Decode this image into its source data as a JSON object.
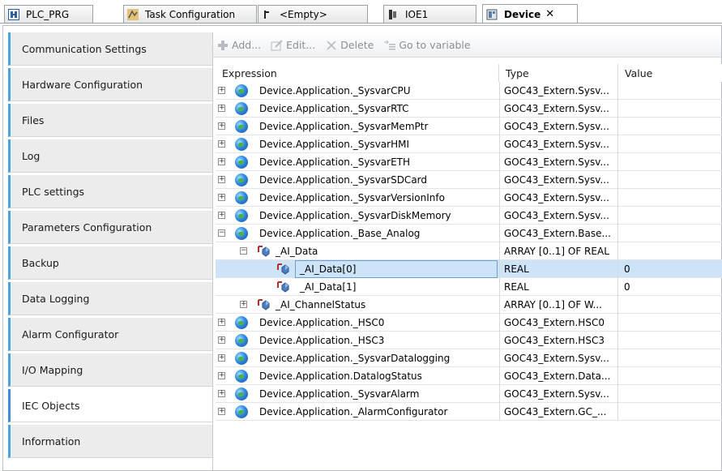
{
  "tabs": [
    {
      "label": "PLC_PRG",
      "icon": "program-icon"
    },
    {
      "label": "Task Configuration",
      "icon": "task-config-icon"
    },
    {
      "label": "<Empty>",
      "icon": "empty-icon"
    },
    {
      "label": "IOE1",
      "icon": "io-module-icon"
    },
    {
      "label": "Device",
      "icon": "device-icon",
      "close": "✕"
    }
  ],
  "sidebar": {
    "items": [
      {
        "label": "Communication Settings"
      },
      {
        "label": "Hardware Configuration"
      },
      {
        "label": "Files"
      },
      {
        "label": "Log"
      },
      {
        "label": "PLC settings"
      },
      {
        "label": "Parameters Configuration"
      },
      {
        "label": "Backup"
      },
      {
        "label": "Data Logging"
      },
      {
        "label": "Alarm Configurator"
      },
      {
        "label": "I/O Mapping"
      },
      {
        "label": "IEC Objects"
      },
      {
        "label": "Information"
      }
    ],
    "active": "IEC Objects"
  },
  "toolbar": {
    "add_label": "Add...",
    "edit_label": "Edit...",
    "delete_label": "Delete",
    "goto_label": "Go to variable"
  },
  "table": {
    "headers": {
      "expression": "Expression",
      "type": "Type",
      "value": "Value"
    },
    "rows": [
      {
        "expression": "Device.Application._SysvarCPU",
        "type": "GOC43_Extern.Sysv...",
        "value": "",
        "level": 0,
        "toggle": "+",
        "icon": "globe"
      },
      {
        "expression": "Device.Application._SysvarRTC",
        "type": "GOC43_Extern.Sysv...",
        "value": "",
        "level": 0,
        "toggle": "+",
        "icon": "globe"
      },
      {
        "expression": "Device.Application._SysvarMemPtr",
        "type": "GOC43_Extern.Sysv...",
        "value": "",
        "level": 0,
        "toggle": "+",
        "icon": "globe"
      },
      {
        "expression": "Device.Application._SysvarHMI",
        "type": "GOC43_Extern.Sysv...",
        "value": "",
        "level": 0,
        "toggle": "+",
        "icon": "globe"
      },
      {
        "expression": "Device.Application._SysvarETH",
        "type": "GOC43_Extern.Sysv...",
        "value": "",
        "level": 0,
        "toggle": "+",
        "icon": "globe"
      },
      {
        "expression": "Device.Application._SysvarSDCard",
        "type": "GOC43_Extern.Sysv...",
        "value": "",
        "level": 0,
        "toggle": "+",
        "icon": "globe"
      },
      {
        "expression": "Device.Application._SysvarVersionInfo",
        "type": "GOC43_Extern.Sysv...",
        "value": "",
        "level": 0,
        "toggle": "+",
        "icon": "globe"
      },
      {
        "expression": "Device.Application._SysvarDiskMemory",
        "type": "GOC43_Extern.Sysv...",
        "value": "",
        "level": 0,
        "toggle": "+",
        "icon": "globe"
      },
      {
        "expression": "Device.Application._Base_Analog",
        "type": "GOC43_Extern.Base...",
        "value": "",
        "level": 0,
        "toggle": "−",
        "icon": "globe"
      },
      {
        "expression": "_AI_Data",
        "type": "ARRAY [0..1] OF REAL",
        "value": "",
        "level": 1,
        "toggle": "−",
        "icon": "var"
      },
      {
        "expression": "_AI_Data[0]",
        "type": "REAL",
        "value": "0",
        "level": 2,
        "toggle": "",
        "icon": "var",
        "selected": true
      },
      {
        "expression": "_AI_Data[1]",
        "type": "REAL",
        "value": "0",
        "level": 2,
        "toggle": "",
        "icon": "var"
      },
      {
        "expression": "_AI_ChannelStatus",
        "type": "ARRAY [0..1] OF W...",
        "value": "",
        "level": 1,
        "toggle": "+",
        "icon": "var"
      },
      {
        "expression": "Device.Application._HSC0",
        "type": "GOC43_Extern.HSC0",
        "value": "",
        "level": 0,
        "toggle": "+",
        "icon": "globe"
      },
      {
        "expression": "Device.Application._HSC3",
        "type": "GOC43_Extern.HSC3",
        "value": "",
        "level": 0,
        "toggle": "+",
        "icon": "globe"
      },
      {
        "expression": "Device.Application._SysvarDatalogging",
        "type": "GOC43_Extern.Sysv...",
        "value": "",
        "level": 0,
        "toggle": "+",
        "icon": "globe"
      },
      {
        "expression": "Device.Application.DatalogStatus",
        "type": "GOC43_Extern.Data...",
        "value": "",
        "level": 0,
        "toggle": "+",
        "icon": "globe"
      },
      {
        "expression": "Device.Application._SysvarAlarm",
        "type": "GOC43_Extern.Sysv...",
        "value": "",
        "level": 0,
        "toggle": "+",
        "icon": "globe"
      },
      {
        "expression": "Device.Application._AlarmConfigurator",
        "type": "GOC43_Extern.GC_...",
        "value": "",
        "level": 0,
        "toggle": "+",
        "icon": "globe"
      }
    ]
  },
  "colors": {
    "accent": "#3b8ed6",
    "selection": "#cde3f7",
    "toolbar_text": "#8a8f95"
  }
}
